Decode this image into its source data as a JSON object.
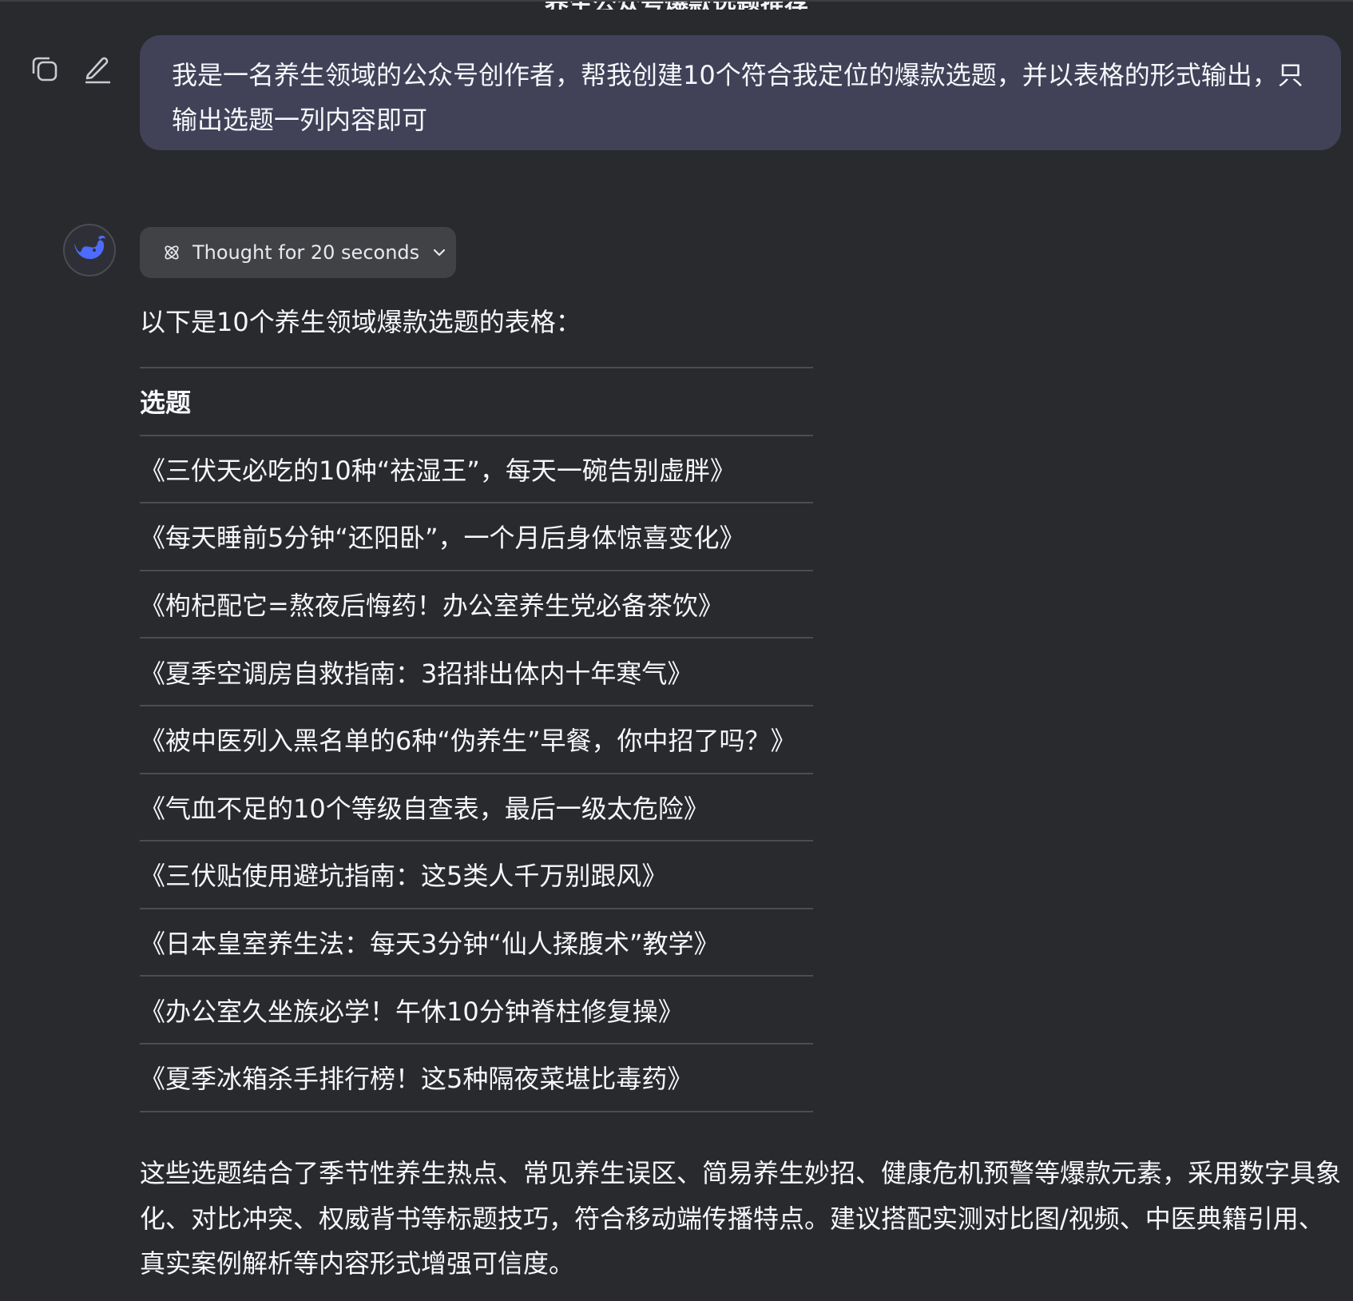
{
  "conversation": {
    "title": "养生公众号爆款选题推荐"
  },
  "user_message": {
    "text": "我是一名养生领域的公众号创作者，帮我创建10个符合我定位的爆款选题，并以表格的形式输出，只输出选题一列内容即可",
    "actions": [
      "copy-icon",
      "edit-icon"
    ]
  },
  "assistant": {
    "avatar_icon": "whale-logo-icon",
    "thought_label": "Thought for 20 seconds",
    "intro": "以下是10个养生领域爆款选题的表格：",
    "table": {
      "header": "选题",
      "rows": [
        "《三伏天必吃的10种“祛湿王”，每天一碗告别虚胖》",
        "《每天睡前5分钟“还阳卧”，一个月后身体惊喜变化》",
        "《枸杞配它=熬夜后悔药！办公室养生党必备茶饮》",
        "《夏季空调房自救指南：3招排出体内十年寒气》",
        "《被中医列入黑名单的6种“伪养生”早餐，你中招了吗？》",
        "《气血不足的10个等级自查表，最后一级太危险》",
        "《三伏贴使用避坑指南：这5类人千万别跟风》",
        "《日本皇室养生法：每天3分钟“仙人揉腹术”教学》",
        "《办公室久坐族必学！午休10分钟脊柱修复操》",
        "《夏季冰箱杀手排行榜！这5种隔夜菜堪比毒药》"
      ]
    },
    "summary": "这些选题结合了季节性养生热点、常见养生误区、简易养生妙招、健康危机预警等爆款元素，采用数字具象化、对比冲突、权威背书等标题技巧，符合移动端传播特点。建议搭配实测对比图/视频、中医典籍引用、真实案例解析等内容形式增强可信度。"
  },
  "colors": {
    "background": "#292a2d",
    "user_bubble": "#414158",
    "thought_button": "#404246",
    "accent_blue": "#4d6bfe",
    "divider": "#4c4d52"
  }
}
